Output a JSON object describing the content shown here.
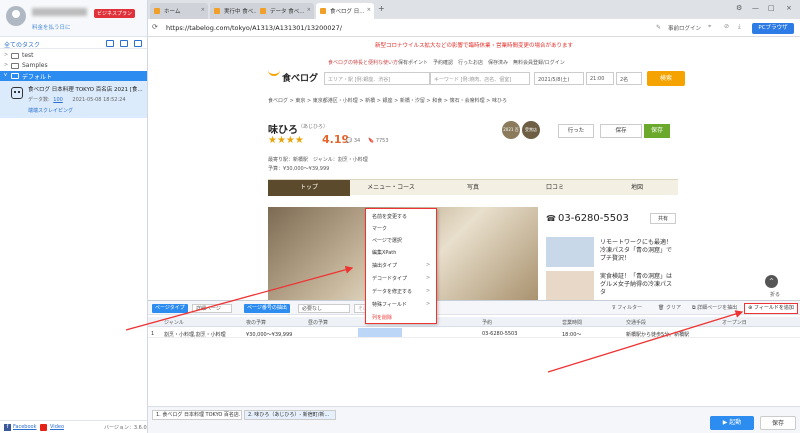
{
  "sidebar": {
    "badge": "ビジネスプラン",
    "sub_text": "料金を払う日に",
    "task_header": "全てのタスク",
    "folders": [
      {
        "label": "test"
      },
      {
        "label": "Samples"
      },
      {
        "label": "デフォルト"
      }
    ],
    "task": {
      "title": "食べログ 日本料理 TOKYO 百名店 2021 [食...",
      "meta_label": "データ数:",
      "meta_count": "100",
      "meta_date": "2021-05-08 18:52:24",
      "link": "端端スクレイピング"
    },
    "footer": {
      "facebook": "Facebook",
      "video": "Video",
      "version": "バージョン：3.6.0"
    }
  },
  "browser": {
    "tabs": [
      {
        "label": "ホーム"
      },
      {
        "label": "実行中 食べ..."
      },
      {
        "label": "データ 食べ..."
      },
      {
        "label": "食べログ 日..."
      }
    ],
    "url": "https://tabelog.com/tokyo/A1313/A131301/13200027/",
    "login": "事前ログイン",
    "pc_button": "PCブラウザ"
  },
  "site": {
    "covid": "新型コロナウイルス拡大などの影響で臨時休業・営業時間変更の場合があります",
    "logo": "食べログ",
    "tagline": "食べログの特長と便利な使い方",
    "nav": "保有ポイント　予約確認　行ったお店　保存済み　無料会員登録/ログイン",
    "search_area": "エリア・駅 [例:銀座、渋谷]",
    "search_keyword": "キーワード [例:焼肉、店名、個室]",
    "search_date": "2021/5/8(土)",
    "search_time": "21:00",
    "search_people": "2名",
    "search_button": "検索",
    "breadcrumb": "食べログ > 東京 > 東京都港区・小料理 > 新橋 > 銀座 > 新橋・汐留 > 和食 > 懐石・会席料理 > 味ひろ",
    "name": "味ひろ",
    "name_kana": "（あじひろ）",
    "stars": "★★★★",
    "score": "4.19",
    "meta": "最寄り駅：新橋駅　ジャンル：割烹・小料理",
    "budget": "予算：¥30,000～¥39,999",
    "went": "行った",
    "save_box": "保存",
    "save_btn": "保存",
    "tabs": [
      "トップ",
      "メニュー・コース",
      "写真",
      "口コミ",
      "地図"
    ],
    "phone": "03-6280-5503",
    "share": "共有",
    "ads": [
      "リモートワークにも最適！冷凍パスタ「青の洞窟」でプチ贅沢！",
      "実食検証！「青の洞窟」はグルメ女子納得の冷凍パスタ"
    ],
    "medals": [
      "2021 百名店",
      "受賞店 2021"
    ]
  },
  "context_menu": [
    "名前を変更する",
    "マーク",
    "ページで選択",
    "編集XPath",
    "抽出タイプ",
    "デコードタイプ",
    "データを修正する",
    "特殊フィールド",
    "列を削除"
  ],
  "panel": {
    "page_type_btn": "ページタイプ",
    "page_type_val": "詳細ページ",
    "page_num_btn": "ページ番号の抽出",
    "page_num_val": "必要なし",
    "other": "その他",
    "filter": "フィルター",
    "clear": "クリア",
    "detail": "詳細ページを抽出",
    "add_field": "フィールドを追加",
    "scroll_up": "^",
    "fold": "折る",
    "columns": [
      "ジャンル",
      "夜の予算",
      "昼の予算",
      "予約",
      "営業時間",
      "交通手段",
      "オープン日"
    ],
    "row": {
      "index": "1",
      "genre": "割烹・小料理,割烹・小料理",
      "night": "¥30,000～¥39,999",
      "day": "",
      "reserve": "03-6280-5503",
      "hours": "18:00～",
      "access": "新橋駅から徒歩5分。新橋駅",
      "open": ""
    }
  },
  "footer": {
    "tabs": [
      "1. 食べログ 日本料理 TOKYO 百名店...",
      "2. 味ひろ（あじひろ）- 新宿町/新..."
    ],
    "run": "起動",
    "save": "保存"
  }
}
